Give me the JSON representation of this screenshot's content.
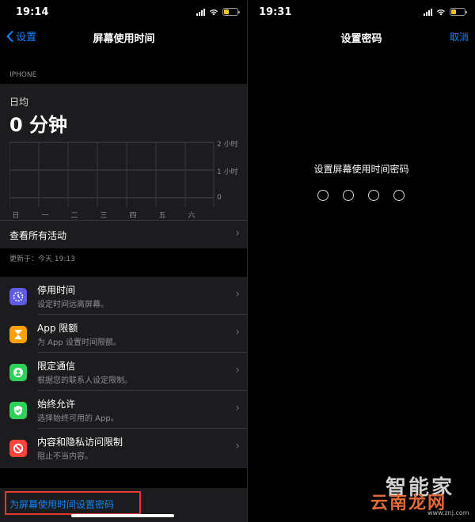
{
  "left_screen": {
    "status_time": "19:14",
    "nav": {
      "back_label": "设置",
      "title": "屏幕使用时间"
    },
    "section_header": "IPHONE",
    "usage": {
      "avg_label": "日均",
      "avg_value": "0 分钟",
      "y_labels": [
        "2 小时",
        "1 小时",
        "0"
      ],
      "days": [
        "日",
        "一",
        "二",
        "三",
        "四",
        "五",
        "六"
      ],
      "see_all_label": "查看所有活动"
    },
    "updated_text": "更新于：今天 19:13",
    "features": [
      {
        "title": "停用时间",
        "subtitle": "设定时间远离屏幕。",
        "icon": "downtime-icon",
        "color": "#5e5ce6"
      },
      {
        "title": "App 限额",
        "subtitle": "为 App 设置时间限额。",
        "icon": "hourglass-icon",
        "color": "#ff9f0a"
      },
      {
        "title": "限定通信",
        "subtitle": "根据您的联系人设定限制。",
        "icon": "contact-icon",
        "color": "#30d158"
      },
      {
        "title": "始终允许",
        "subtitle": "选择始终可用的 App。",
        "icon": "checkmark-shield-icon",
        "color": "#30d158"
      },
      {
        "title": "内容和隐私访问限制",
        "subtitle": "阻止不当内容。",
        "icon": "restriction-icon",
        "color": "#ff453a"
      }
    ],
    "passcode_link": "为屏幕使用时间设置密码"
  },
  "right_screen": {
    "status_time": "19:31",
    "nav": {
      "title": "设置密码",
      "cancel_label": "取消"
    },
    "prompt": "设置屏幕使用时间密码",
    "passcode_length": 4
  },
  "watermark": {
    "line1": "智能家",
    "line2": "云南龙网",
    "url": "www.znj.com"
  },
  "colors": {
    "accent": "#0a84ff",
    "highlight_border": "#e53935",
    "battery": "#f5c518"
  }
}
